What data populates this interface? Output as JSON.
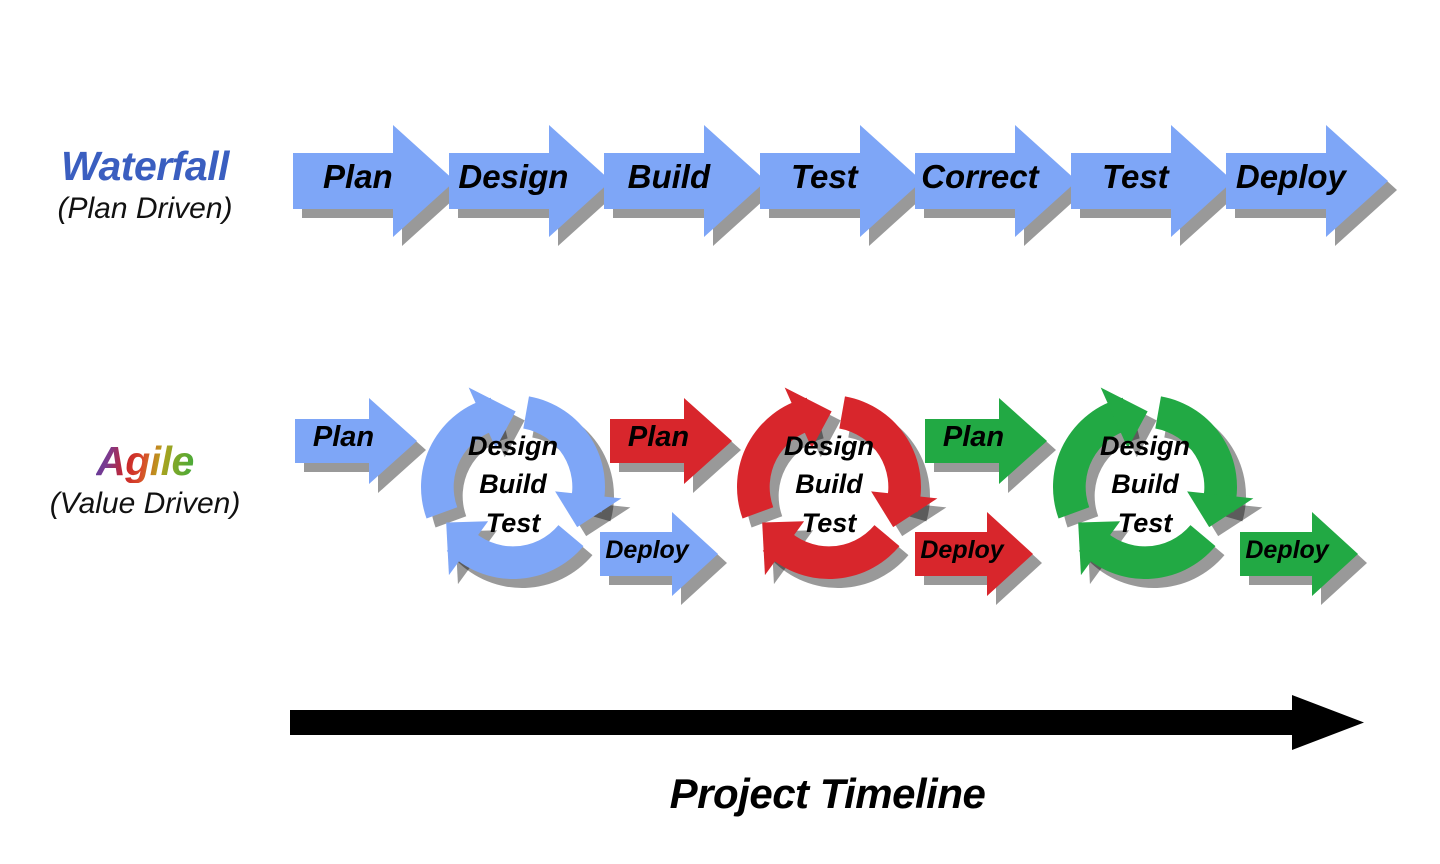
{
  "diagram": {
    "title_alt": "Waterfall vs Agile Project Timeline",
    "background": "#ffffff"
  },
  "colors": {
    "blue": "#7ea6f7",
    "red": "#d8262c",
    "green": "#22a944",
    "black": "#000000",
    "waterfall_title": "#3a5ec0",
    "shadow": "rgba(0,0,0,0.42)"
  },
  "rows": {
    "waterfall": {
      "title": "Waterfall",
      "subtitle": "(Plan Driven)",
      "steps": [
        {
          "label": "Plan",
          "color": "blue"
        },
        {
          "label": "Design",
          "color": "blue"
        },
        {
          "label": "Build",
          "color": "blue"
        },
        {
          "label": "Test",
          "color": "blue"
        },
        {
          "label": "Correct",
          "color": "blue"
        },
        {
          "label": "Test",
          "color": "blue"
        },
        {
          "label": "Deploy",
          "color": "blue"
        }
      ]
    },
    "agile": {
      "title": "Agile",
      "subtitle": "(Value Driven)",
      "cycle_lines": [
        "Design",
        "Build",
        "Test"
      ],
      "iterations": [
        {
          "color": "blue",
          "plan_label": "Plan",
          "cycle_lines": [
            "Design",
            "Build",
            "Test"
          ],
          "deploy_label": "Deploy",
          "deploy_color": "blue"
        },
        {
          "color": "red",
          "plan_label": "Plan",
          "cycle_lines": [
            "Design",
            "Build",
            "Test"
          ],
          "deploy_label": "Deploy",
          "deploy_color": "red"
        },
        {
          "color": "green",
          "plan_label": "Plan",
          "cycle_lines": [
            "Design",
            "Build",
            "Test"
          ],
          "deploy_label": "Deploy",
          "deploy_color": "green"
        }
      ]
    }
  },
  "timeline": {
    "caption": "Project Timeline",
    "direction": "left-to-right",
    "color": "#000000"
  }
}
